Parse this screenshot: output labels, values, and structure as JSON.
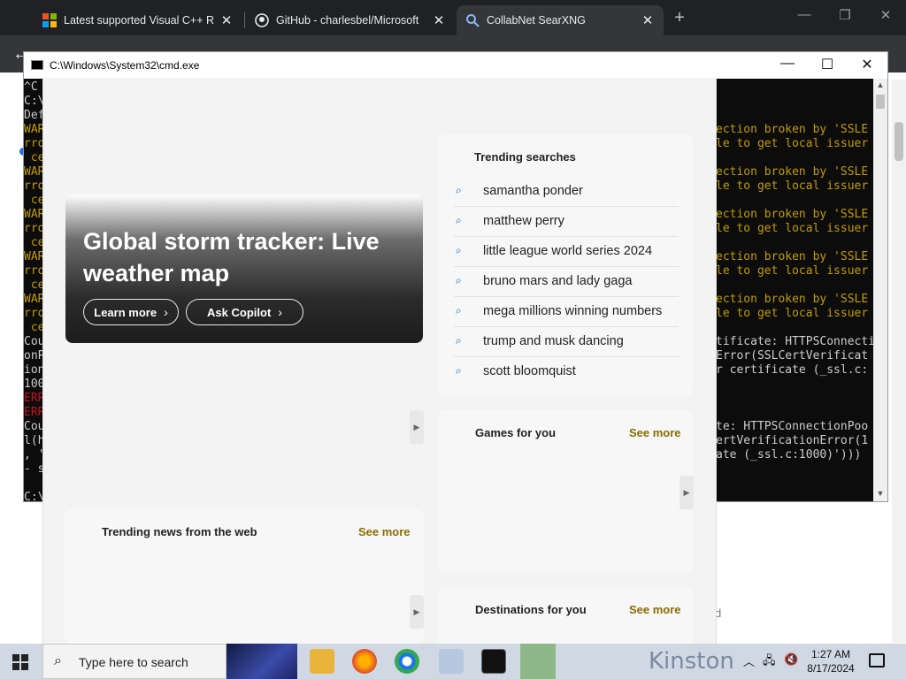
{
  "browser": {
    "tabs": [
      {
        "title": "Latest supported Visual C++ R",
        "icon": "microsoft-logo-icon",
        "active": false
      },
      {
        "title": "GitHub - charlesbel/Microsoft",
        "icon": "github-icon",
        "active": false
      },
      {
        "title": "CollabNet SearXNG",
        "icon": "search-icon",
        "active": true
      }
    ],
    "new_tab": "+",
    "back": "←"
  },
  "cmd": {
    "title": "C:\\Windows\\System32\\cmd.exe",
    "lines": [
      {
        "left": "^C",
        "right": "",
        "rc": ""
      },
      {
        "left": "C:\\",
        "right": "",
        "rc": ""
      },
      {
        "left": "Def",
        "right": "",
        "rc": ""
      },
      {
        "left": "WAR",
        "lc": "y",
        "right": "ection broken by 'SSLE",
        "rc": "y"
      },
      {
        "left": "rro",
        "lc": "y",
        "right": "le to get local issuer",
        "rc": "y"
      },
      {
        "left": " ce",
        "lc": "y",
        "right": "",
        "rc": ""
      },
      {
        "left": "WAR",
        "lc": "y",
        "right": "ection broken by 'SSLE",
        "rc": "y"
      },
      {
        "left": "rro",
        "lc": "y",
        "right": "le to get local issuer",
        "rc": "y"
      },
      {
        "left": " ce",
        "lc": "y",
        "right": "",
        "rc": ""
      },
      {
        "left": "WAR",
        "lc": "y",
        "right": "ection broken by 'SSLE",
        "rc": "y"
      },
      {
        "left": "rro",
        "lc": "y",
        "right": "le to get local issuer",
        "rc": "y"
      },
      {
        "left": " ce",
        "lc": "y",
        "right": "",
        "rc": ""
      },
      {
        "left": "WAR",
        "lc": "y",
        "right": "ection broken by 'SSLE",
        "rc": "y"
      },
      {
        "left": "rro",
        "lc": "y",
        "right": "le to get local issuer",
        "rc": "y"
      },
      {
        "left": " ce",
        "lc": "y",
        "right": "",
        "rc": ""
      },
      {
        "left": "WAR",
        "lc": "y",
        "right": "ection broken by 'SSLE",
        "rc": "y"
      },
      {
        "left": "rro",
        "lc": "y",
        "right": "le to get local issuer",
        "rc": "y"
      },
      {
        "left": " ce",
        "lc": "y",
        "right": "",
        "rc": ""
      },
      {
        "left": "Cou",
        "right": "tificate: HTTPSConnecti",
        "rc": ""
      },
      {
        "left": "onP",
        "right": "Error(SSLCertVerificat",
        "rc": ""
      },
      {
        "left": "ion",
        "right": "r certificate (_ssl.c:",
        "rc": ""
      },
      {
        "left": "100",
        "right": "",
        "rc": ""
      },
      {
        "left": "ERR",
        "lc": "r",
        "right": "",
        "rc": ""
      },
      {
        "left": "ERR",
        "lc": "r",
        "right": "",
        "rc": ""
      },
      {
        "left": "Cou",
        "right": "te: HTTPSConnectionPoo",
        "rc": ""
      },
      {
        "left": "l(h",
        "right": "ertVerificationError(1",
        "rc": ""
      },
      {
        "left": ", '",
        "right": "ate (_ssl.c:1000)')))",
        "rc": ""
      },
      {
        "left": "- s",
        "right": "",
        "rc": ""
      },
      {
        "left": "",
        "right": "",
        "rc": ""
      },
      {
        "left": "C:\\",
        "right": "",
        "rc": ""
      }
    ]
  },
  "hero": {
    "title": "Global storm tracker: Live weather map",
    "learn_more": "Learn more",
    "ask_copilot": "Ask Copilot"
  },
  "trending": {
    "title": "Trending searches",
    "items": [
      "samantha ponder",
      "matthew perry",
      "little league world series 2024",
      "bruno mars and lady gaga",
      "mega millions winning numbers",
      "trump and musk dancing",
      "scott bloomquist"
    ]
  },
  "games": {
    "title": "Games for you",
    "see_more": "See more"
  },
  "news": {
    "title": "Trending news from the web",
    "see_more": "See more"
  },
  "destinations": {
    "title": "Destinations for you",
    "see_more": "See more"
  },
  "taskbar": {
    "search_placeholder": "Type here to search",
    "bg_text": "Kinston",
    "time": "1:27 AM",
    "date": "8/17/2024"
  },
  "colors": {
    "accent_link": "#8a6d00",
    "taskbar": "#cfd8e3",
    "cmd_warning": "#c19c00",
    "cmd_error": "#c50f1f"
  }
}
